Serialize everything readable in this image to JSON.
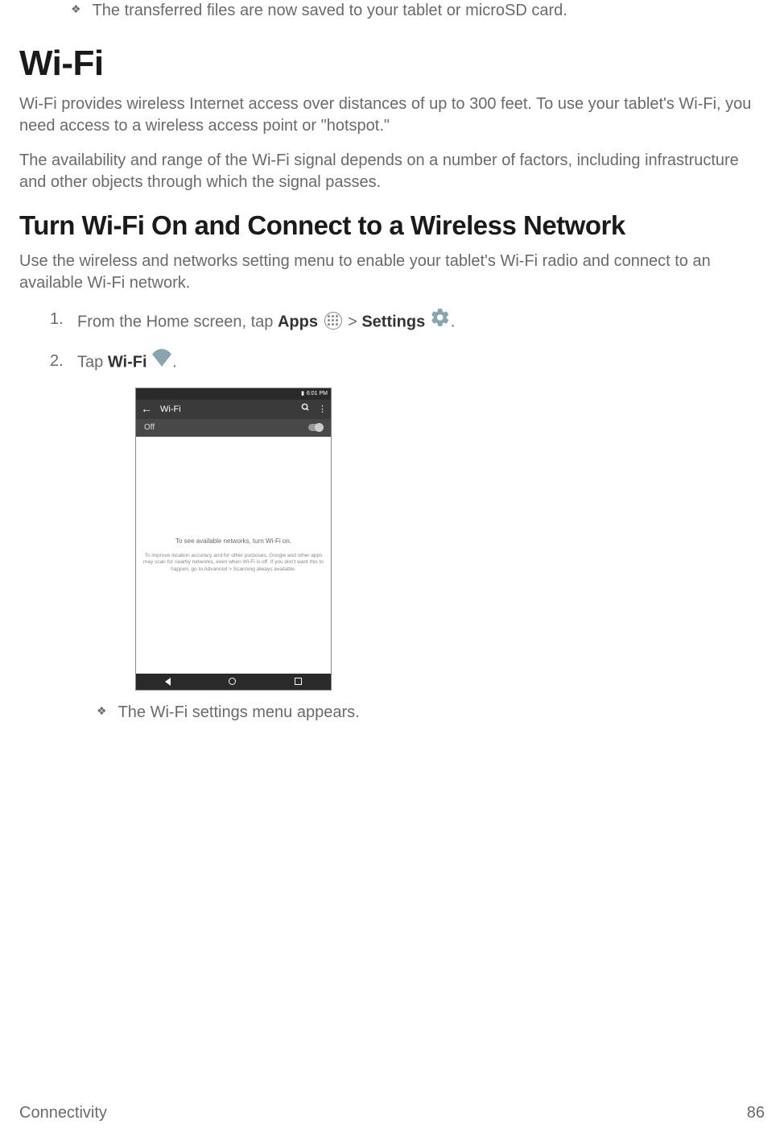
{
  "top_bullet": "The transferred files are now saved to your tablet or microSD card.",
  "h1": "Wi-Fi",
  "p1": "Wi-Fi provides wireless Internet access over distances of up to 300 feet. To use your tablet's Wi-Fi, you need access to a wireless access point or \"hotspot.\"",
  "p2": "The availability and range of the Wi-Fi signal depends on a number of factors, including infrastructure and other objects through which the signal passes.",
  "h2": "Turn Wi-Fi On and Connect to a Wireless Network",
  "p3": "Use the wireless and networks setting menu to enable your tablet's Wi-Fi radio and connect to an available Wi-Fi network.",
  "step1": {
    "pre": "From the Home screen, tap ",
    "apps": "Apps",
    "gt": " > ",
    "settings": "Settings"
  },
  "step2": {
    "pre": "Tap ",
    "wifi": "Wi-Fi"
  },
  "screenshot": {
    "time": "6:01 PM",
    "title": "Wi-Fi",
    "toggle_label": "Off",
    "hint1": "To see available networks, turn Wi-Fi on.",
    "hint2": "To improve location accuracy and for other purposes, Google and other apps may scan for nearby networks, even when Wi-Fi is off. If you don't want this to happen, go to Advanced > Scanning always available."
  },
  "bottom_bullet": "The Wi-Fi settings menu appears.",
  "footer_left": "Connectivity",
  "footer_right": "86"
}
